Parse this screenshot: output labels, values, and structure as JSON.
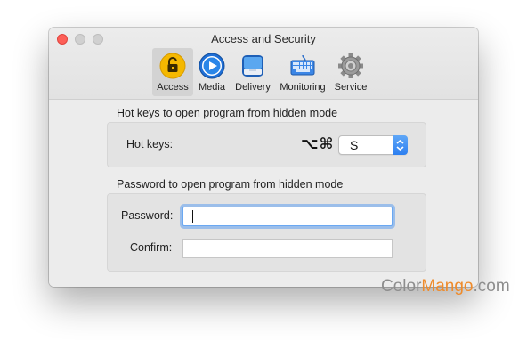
{
  "window": {
    "title": "Access and Security"
  },
  "toolbar": {
    "items": [
      {
        "label": "Access",
        "icon": "lock-icon",
        "selected": true
      },
      {
        "label": "Media",
        "icon": "play-icon",
        "selected": false
      },
      {
        "label": "Delivery",
        "icon": "inbox-icon",
        "selected": false
      },
      {
        "label": "Monitoring",
        "icon": "keyboard-icon",
        "selected": false
      },
      {
        "label": "Service",
        "icon": "gear-icon",
        "selected": false
      }
    ]
  },
  "hotkeys": {
    "section_title": "Hot keys to open program from hidden mode",
    "label": "Hot keys:",
    "modifiers": "⌥⌘",
    "key_value": "S"
  },
  "password": {
    "section_title": "Password to open program from hidden mode",
    "password_label": "Password:",
    "password_value": "",
    "confirm_label": "Confirm:",
    "confirm_value": ""
  },
  "watermark": {
    "part1": "Color",
    "part2": "Mango",
    "part3": ".com"
  },
  "colors": {
    "accent": "#2d7ff0",
    "close": "#fd5f57",
    "watermark_orange": "#ef8b2b"
  }
}
